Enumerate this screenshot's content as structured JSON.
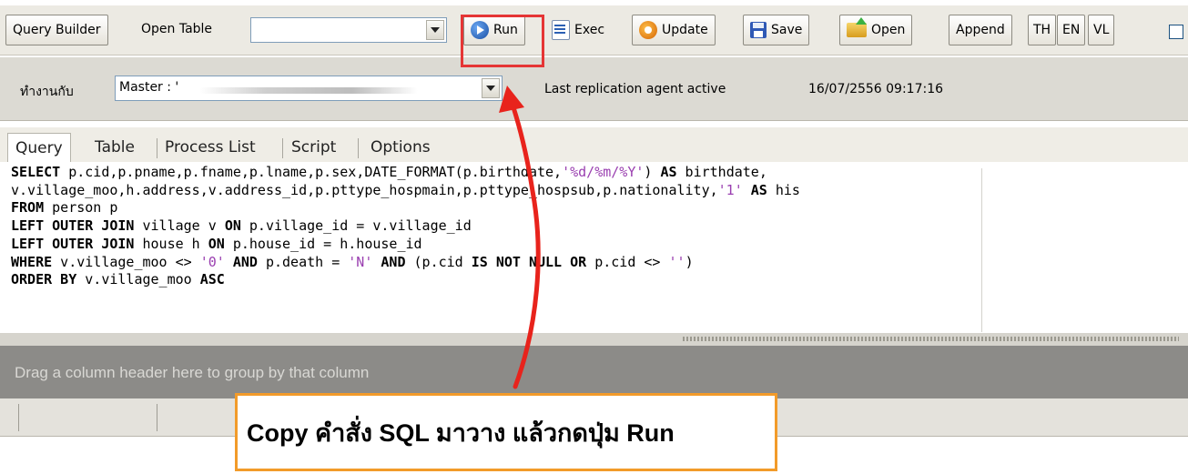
{
  "toolbar": {
    "query_builder": "Query Builder",
    "open_table_label": "Open Table",
    "open_table_value": "",
    "run": "Run",
    "exec": "Exec",
    "update": "Update",
    "save": "Save",
    "open": "Open",
    "append": "Append",
    "lang_th": "TH",
    "lang_en": "EN",
    "lang_vl": "VL"
  },
  "connection": {
    "label": "ทำงานกับ",
    "server_value": "Master : '",
    "status": "Last replication agent active",
    "timestamp": "16/07/2556 09:17:16"
  },
  "tabs": [
    "Query",
    "Table",
    "Process List",
    "Script",
    "Options"
  ],
  "sql_lines": [
    [
      {
        "t": "SELECT",
        "k": "kw"
      },
      {
        "t": " p.cid,p.pname,p.fname,p.lname,p.sex,DATE_FORMAT(p.birthdate,"
      },
      {
        "t": "'%d/%m/%Y'",
        "k": "str"
      },
      {
        "t": ") "
      },
      {
        "t": "AS",
        "k": "kw"
      },
      {
        "t": " birthdate,"
      }
    ],
    [
      {
        "t": "v.village_moo,h.address,v.address_id,p.pttype_hospmain,p.pttype_hospsub,p.nationality,"
      },
      {
        "t": "'1'",
        "k": "str"
      },
      {
        "t": " "
      },
      {
        "t": "AS",
        "k": "kw"
      },
      {
        "t": " his"
      }
    ],
    [
      {
        "t": "FROM",
        "k": "kw"
      },
      {
        "t": " person p"
      }
    ],
    [
      {
        "t": "LEFT OUTER JOIN",
        "k": "kw"
      },
      {
        "t": " village v "
      },
      {
        "t": "ON",
        "k": "kw"
      },
      {
        "t": " p.village_id = v.village_id"
      }
    ],
    [
      {
        "t": "LEFT OUTER JOIN",
        "k": "kw"
      },
      {
        "t": " house h "
      },
      {
        "t": "ON",
        "k": "kw"
      },
      {
        "t": " p.house_id = h.house_id"
      }
    ],
    [
      {
        "t": "WHERE",
        "k": "kw"
      },
      {
        "t": " v.village_moo <> "
      },
      {
        "t": "'0'",
        "k": "str"
      },
      {
        "t": " "
      },
      {
        "t": "AND",
        "k": "kw"
      },
      {
        "t": " p.death = "
      },
      {
        "t": "'N'",
        "k": "str"
      },
      {
        "t": " "
      },
      {
        "t": "AND",
        "k": "kw"
      },
      {
        "t": " (p.cid "
      },
      {
        "t": "IS NOT NULL",
        "k": "kw"
      },
      {
        "t": " "
      },
      {
        "t": "OR",
        "k": "kw"
      },
      {
        "t": " p.cid <> "
      },
      {
        "t": "''",
        "k": "str"
      },
      {
        "t": ")"
      }
    ],
    [
      {
        "t": "ORDER BY",
        "k": "kw"
      },
      {
        "t": " v.village_moo "
      },
      {
        "t": "ASC",
        "k": "kw"
      }
    ]
  ],
  "grid": {
    "group_hint": "Drag a column header here to group by that column"
  },
  "callout": {
    "text": "Copy คำสั่ง SQL มาวาง แล้วกดปุ่ม Run"
  },
  "colors": {
    "highlight_box": "#e53535",
    "arrow": "#e8231c",
    "callout_border": "#f29b2a"
  }
}
